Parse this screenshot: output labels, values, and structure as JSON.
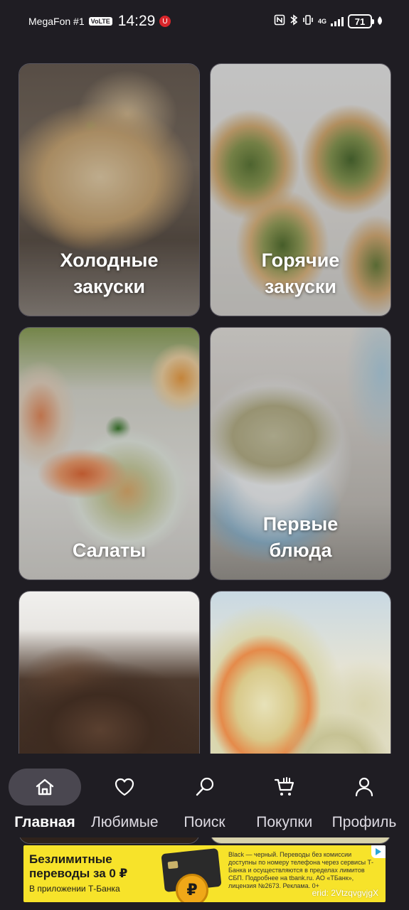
{
  "status_bar": {
    "carrier": "MegaFon #1",
    "volte": "VoLTE",
    "time": "14:29",
    "network": "4G",
    "battery": "71"
  },
  "categories": [
    {
      "title": "Холодные\nзакуски",
      "image": "cold-appetizers-photo"
    },
    {
      "title": "Горячие\nзакуски",
      "image": "hot-appetizers-photo"
    },
    {
      "title": "Салаты",
      "image": "salads-photo"
    },
    {
      "title": "Первые\nблюда",
      "image": "soups-photo"
    },
    {
      "title": "",
      "image": "grilled-meat-photo"
    },
    {
      "title": "",
      "image": "cabbage-salad-photo"
    }
  ],
  "nav": {
    "active": "home",
    "items": [
      {
        "id": "home",
        "label": "Главная",
        "icon": "home-icon"
      },
      {
        "id": "favorites",
        "label": "Любимые",
        "icon": "heart-icon"
      },
      {
        "id": "search",
        "label": "Поиск",
        "icon": "search-icon"
      },
      {
        "id": "purchases",
        "label": "Покупки",
        "icon": "cart-icon"
      },
      {
        "id": "profile",
        "label": "Профиль",
        "icon": "user-icon"
      }
    ]
  },
  "ad": {
    "headline": "Безлимитные\nпереводы за 0 ₽",
    "subline": "В приложении Т-Банка",
    "legal": "Black — черный. Переводы без комиссии доступны по номеру телефона через сервисы Т-Банка и осуществляются в пределах лимитов СБП. Подробнее на tbank.ru. АО «ТБанк», лицензия №2673. Реклама. 0+",
    "erid": "erid: 2VtzqvgvjgX",
    "coin_symbol": "₽",
    "accent_color": "#f7e32a"
  }
}
